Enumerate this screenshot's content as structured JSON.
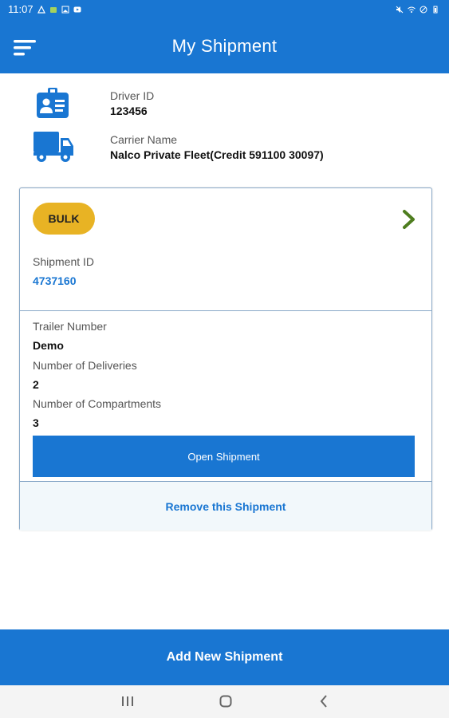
{
  "status_bar": {
    "time": "11:07",
    "left_icons": [
      "alert-icon",
      "android-icon",
      "image-icon",
      "youtube-icon"
    ],
    "right_icons": [
      "mute-icon",
      "wifi-icon",
      "dnd-icon",
      "battery-icon"
    ]
  },
  "app_bar": {
    "title": "My Shipment",
    "menu_icon": "hamburger-menu-icon"
  },
  "driver": {
    "label": "Driver ID",
    "value": "123456",
    "icon": "id-badge-icon"
  },
  "carrier": {
    "label": "Carrier Name",
    "value": "Nalco Private Fleet(Credit 591100 30097)",
    "icon": "truck-icon"
  },
  "shipment_card": {
    "badge": "BULK",
    "chevron_icon": "chevron-right-icon",
    "shipment_id_label": "Shipment ID",
    "shipment_id": "4737160",
    "trailer_label": "Trailer Number",
    "trailer_value": "Demo",
    "deliveries_label": "Number of Deliveries",
    "deliveries_value": "2",
    "compartments_label": "Number of Compartments",
    "compartments_value": "3",
    "open_button": "Open Shipment",
    "remove_link": "Remove this Shipment"
  },
  "add_button": "Add New Shipment",
  "nav_bar": {
    "icons": [
      "recent-apps-icon",
      "home-icon",
      "back-icon"
    ]
  },
  "colors": {
    "primary": "#1976d2",
    "badge": "#e8b324",
    "chevron": "#4e7d1f",
    "remove_bg": "#f2f8fb"
  }
}
